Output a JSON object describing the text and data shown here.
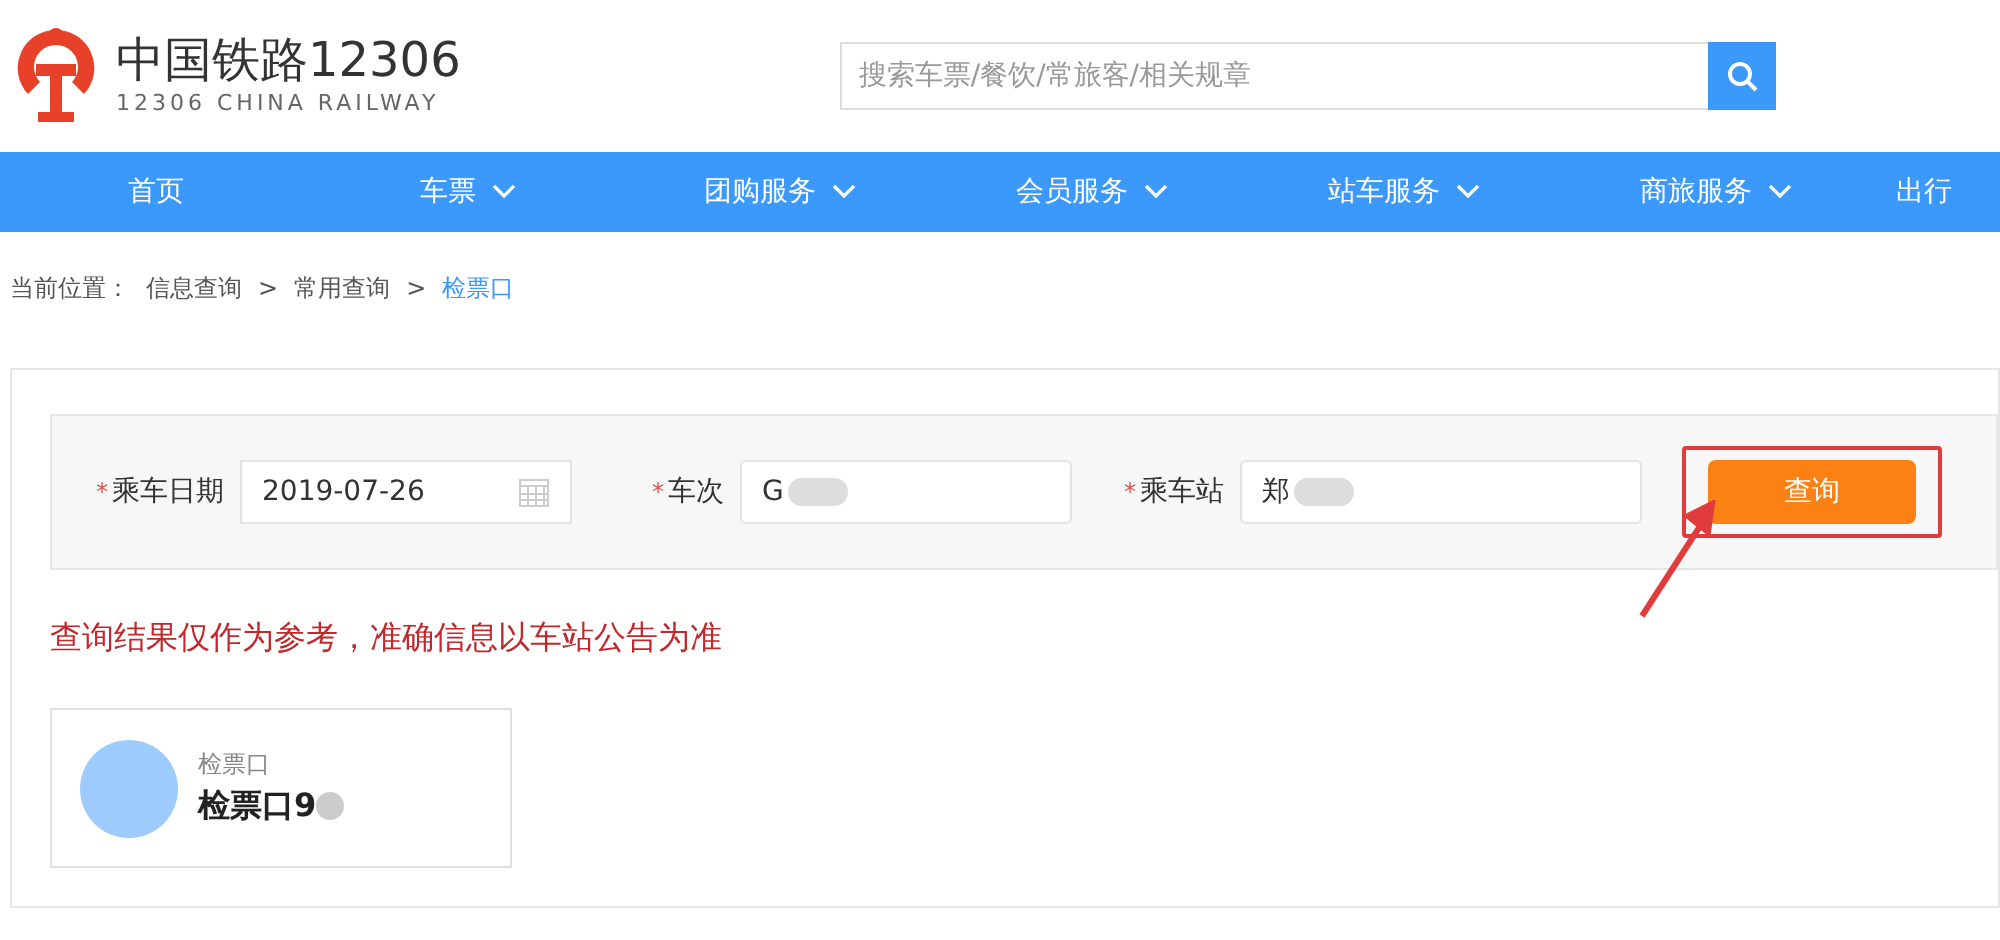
{
  "logo": {
    "title": "中国铁路12306",
    "subtitle": "12306 CHINA RAILWAY"
  },
  "search": {
    "placeholder": "搜索车票/餐饮/常旅客/相关规章"
  },
  "nav": [
    {
      "label": "首页",
      "dropdown": false
    },
    {
      "label": "车票",
      "dropdown": true
    },
    {
      "label": "团购服务",
      "dropdown": true
    },
    {
      "label": "会员服务",
      "dropdown": true
    },
    {
      "label": "站车服务",
      "dropdown": true
    },
    {
      "label": "商旅服务",
      "dropdown": true
    },
    {
      "label": "出行",
      "dropdown": false
    }
  ],
  "breadcrumb": {
    "label": "当前位置：",
    "items": [
      {
        "text": "信息查询",
        "current": false
      },
      {
        "text": "常用查询",
        "current": false
      },
      {
        "text": "检票口",
        "current": true
      }
    ],
    "separators": [
      ">",
      ">"
    ]
  },
  "form": {
    "fields": [
      {
        "kind": "date",
        "required_mark": "*",
        "label": "乘车日期",
        "value": "2019-07-26"
      },
      {
        "kind": "text",
        "required_mark": "*",
        "label": "车次",
        "value": "G"
      },
      {
        "kind": "text",
        "required_mark": "*",
        "label": "乘车站",
        "value": "郑"
      }
    ],
    "button": "查询"
  },
  "notice": "查询结果仅作为参考，准确信息以车站公告为准",
  "result": {
    "label": "检票口",
    "value": "检票口9"
  }
}
